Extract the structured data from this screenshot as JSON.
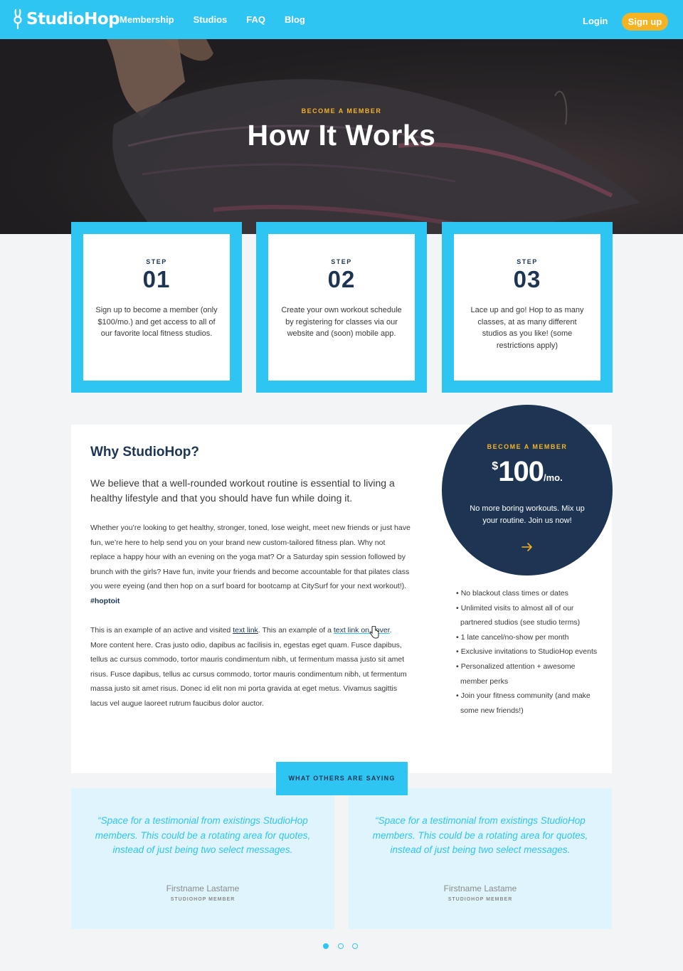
{
  "nav": {
    "logo": "StudioHop",
    "links": [
      "Membership",
      "Studios",
      "FAQ",
      "Blog"
    ],
    "login": "Login",
    "signup": "Sign up"
  },
  "hero": {
    "eyebrow": "BECOME A MEMBER",
    "title": "How It Works"
  },
  "steps": [
    {
      "label": "STEP",
      "number": "01",
      "text": "Sign up to become a member (only $100/mo.) and get access to all of our favorite local fitness studios."
    },
    {
      "label": "STEP",
      "number": "02",
      "text": "Create your own workout schedule by registering for classes via our website and (soon) mobile app."
    },
    {
      "label": "STEP",
      "number": "03",
      "text": "Lace up and go! Hop to as many classes, at as many different studios as you like! (some restrictions apply)"
    }
  ],
  "why": {
    "title": "Why StudioHop?",
    "lead": "We believe that a well-rounded workout routine is essential to living a healthy lifestyle and that you should have fun while doing it.",
    "body": "Whether you’re looking to get healthy, stronger, toned, lose weight, meet new friends or just have fun, we’re here to help send you on your brand new custom-tailored fitness plan. Why not replace a happy hour with an evening on the yoga mat? Or a Saturday spin session followed by brunch with the girls? Have fun, invite your friends and become accountable for that pilates class you were eyeing (and then hop on a surf board for bootcamp at CitySurf for your next workout!).",
    "hashtag": "#hoptoit",
    "body2_a": "This is an example of an active and visited ",
    "link1": "text link",
    "body2_b": ". This an example of a ",
    "link2": "text link on hover",
    "body2_c": ". More content here. Cras justo odio, dapibus ac facilisis in, egestas eget quam. Fusce dapibus, tellus ac cursus commodo, tortor mauris condimentum nibh, ut fermentum massa justo sit amet risus. Fusce dapibus, tellus ac cursus commodo, tortor mauris condimentum nibh, ut fermentum massa justo sit amet risus. Donec id elit non mi porta gravida at eget metus. Vivamus sagittis lacus vel augue laoreet rutrum faucibus dolor auctor."
  },
  "membership": {
    "eyebrow": "BECOME A MEMBER",
    "currency": "$",
    "amount": "100",
    "period": "/mo.",
    "text": "No more boring workouts. Mix up your routine. Join us now!",
    "arrow_icon": "arrow-right-icon"
  },
  "benefits": [
    "No blackout class times or dates",
    "Unlimited visits to almost all of our partnered studios (see studio terms)",
    "1 late cancel/no-show per month",
    "Exclusive invitations to StudioHop events",
    "Personalized attention + awesome member perks",
    "Join your fitness community (and make some new friends!)"
  ],
  "testimonials": {
    "label": "WHAT OTHERS ARE SAYING",
    "items": [
      {
        "quote": "“Space for a testimonial from existings StudioHop members. This could be a rotating area for quotes, instead of just being two select messages.",
        "name": "Firstname Lastame",
        "role": "STUDIOHOP MEMBER"
      },
      {
        "quote": "“Space for a testimonial from existings StudioHop members. This could be a rotating area for quotes, instead of just being two select messages.",
        "name": "Firstname Lastame",
        "role": "STUDIOHOP MEMBER"
      }
    ],
    "pages": 3,
    "active_page": 1
  },
  "colors": {
    "accent": "#2ec5f2",
    "navy": "#1d3553",
    "gold": "#f5b324",
    "light_blue": "#dff4fc"
  }
}
